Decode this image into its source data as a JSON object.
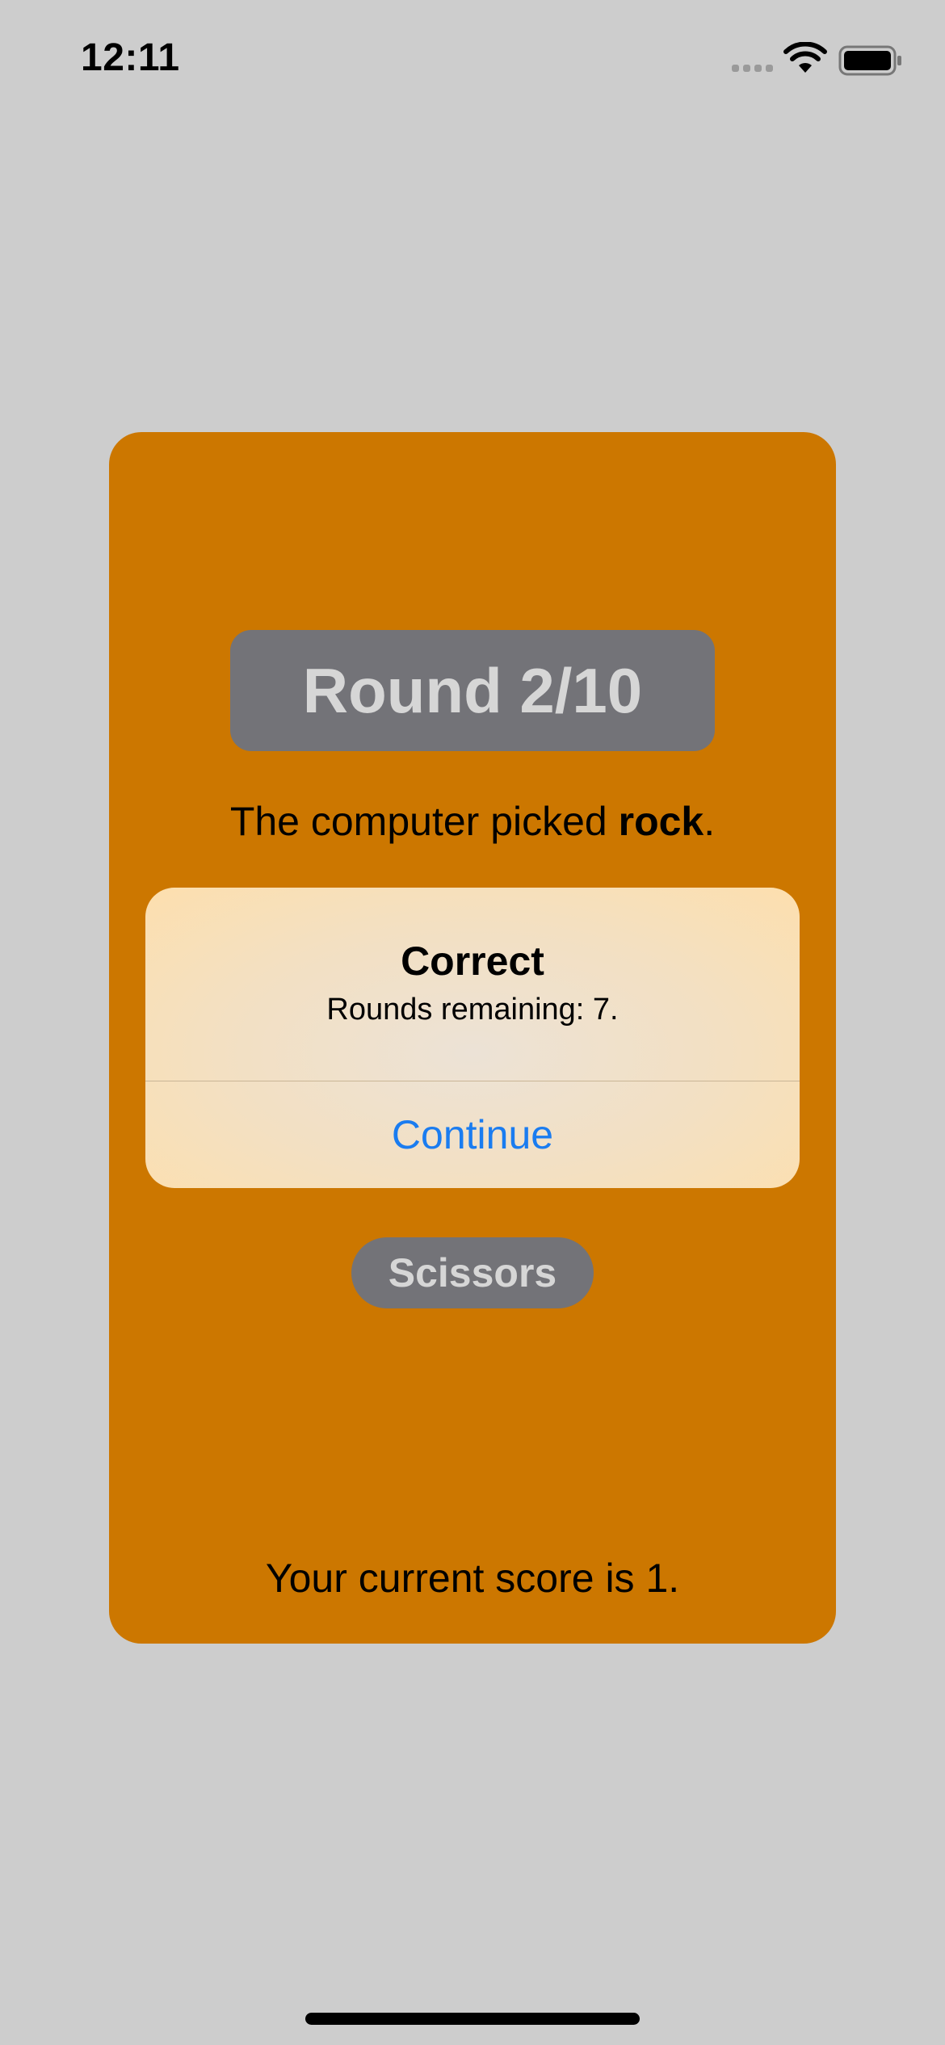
{
  "status_bar": {
    "time": "12:11",
    "icons": [
      "signal-icon",
      "wifi-icon",
      "battery-icon"
    ]
  },
  "game": {
    "round_label": "Round 2/10",
    "computer_pick": {
      "prefix": "The computer picked ",
      "choice": "rock",
      "suffix": "."
    },
    "move_button_label": "Scissors",
    "score_text": "Your current score is 1."
  },
  "alert": {
    "title": "Correct",
    "message": "Rounds remaining: 7.",
    "button_label": "Continue"
  },
  "colors": {
    "background": "#cdcdcd",
    "card": "#cc7700",
    "pill": "#737378",
    "pill_text": "#d6d6d6",
    "alert_button": "#1a7cf0"
  }
}
